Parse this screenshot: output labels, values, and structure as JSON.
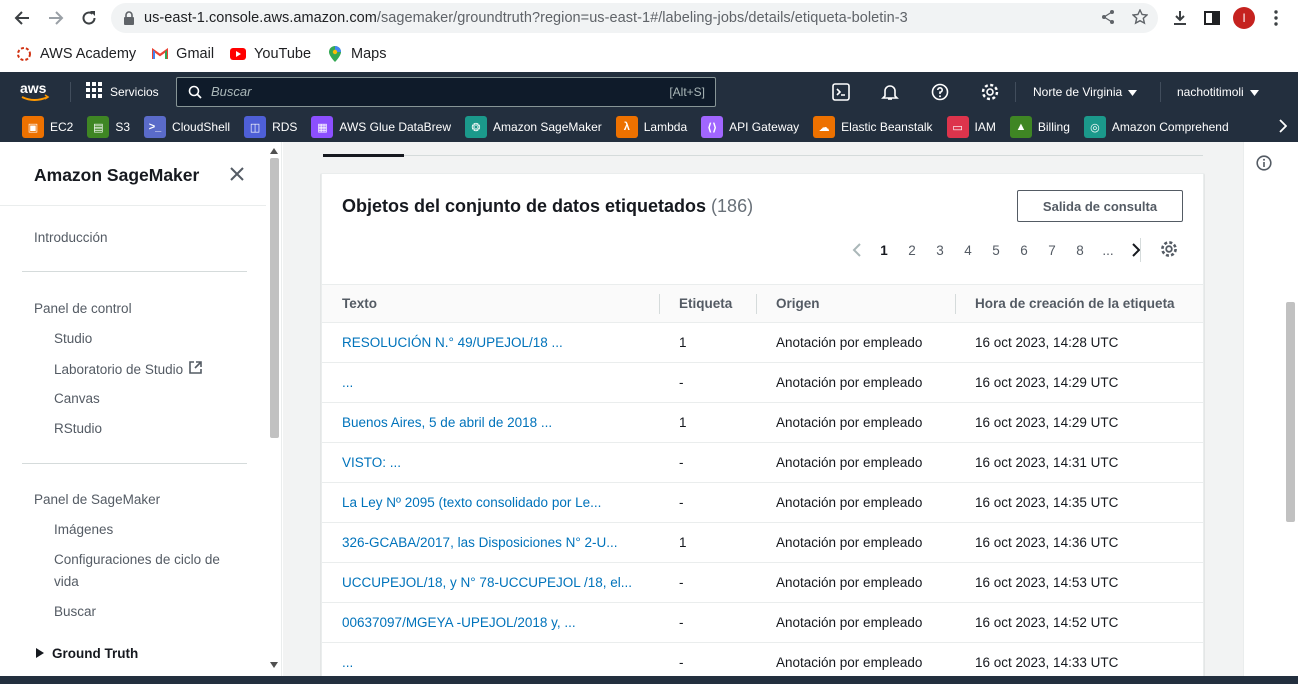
{
  "browser": {
    "url_host": "us-east-1.console.aws.amazon.com",
    "url_path": "/sagemaker/groundtruth?region=us-east-1#/labeling-jobs/details/etiqueta-boletin-3",
    "profile_initial": "I"
  },
  "bookmarks": [
    {
      "label": "AWS Academy",
      "icon": "aws-academy-icon"
    },
    {
      "label": "Gmail",
      "icon": "gmail-icon"
    },
    {
      "label": "YouTube",
      "icon": "youtube-icon"
    },
    {
      "label": "Maps",
      "icon": "maps-icon"
    }
  ],
  "aws_header": {
    "logo": "aws",
    "services_label": "Servicios",
    "search_placeholder": "Buscar",
    "search_shortcut": "[Alt+S]",
    "region": "Norte de Virginia",
    "user": "nachotitimoli"
  },
  "favorites": [
    {
      "label": "EC2",
      "color": "#ed7100",
      "glyph": "▣"
    },
    {
      "label": "S3",
      "color": "#3f8624",
      "glyph": "▤"
    },
    {
      "label": "CloudShell",
      "color": "#5a6bc9",
      "glyph": ">_"
    },
    {
      "label": "RDS",
      "color": "#4e5fd6",
      "glyph": "◫"
    },
    {
      "label": "AWS Glue DataBrew",
      "color": "#8c4fff",
      "glyph": "▦"
    },
    {
      "label": "Amazon SageMaker",
      "color": "#1b998b",
      "glyph": "❂"
    },
    {
      "label": "Lambda",
      "color": "#ed7100",
      "glyph": "λ"
    },
    {
      "label": "API Gateway",
      "color": "#a166ff",
      "glyph": "⟨⟩"
    },
    {
      "label": "Elastic Beanstalk",
      "color": "#ed7100",
      "glyph": "☁"
    },
    {
      "label": "IAM",
      "color": "#dd344c",
      "glyph": "▭"
    },
    {
      "label": "Billing",
      "color": "#3f8624",
      "glyph": "▲"
    },
    {
      "label": "Amazon Comprehend",
      "color": "#1b998b",
      "glyph": "◎"
    }
  ],
  "sidebar": {
    "title": "Amazon SageMaker",
    "intro": "Introducción",
    "section1": "Panel de control",
    "items1": [
      "Studio",
      "Laboratorio de Studio",
      "Canvas",
      "RStudio"
    ],
    "section2": "Panel de SageMaker",
    "items2": [
      "Imágenes",
      "Configuraciones de ciclo de",
      "vida",
      "Buscar"
    ],
    "ground_truth": "Ground Truth"
  },
  "panel": {
    "title": "Objetos del conjunto de datos etiquetados",
    "count": "(186)",
    "query_button": "Salida de consulta",
    "pages": [
      "1",
      "2",
      "3",
      "4",
      "5",
      "6",
      "7",
      "8",
      "..."
    ],
    "active_page": "1"
  },
  "table": {
    "headers": [
      "Texto",
      "Etiqueta",
      "Origen",
      "Hora de creación de la etiqueta"
    ],
    "rows": [
      {
        "text": "RESOLUCIÓN N.° 49/UPEJOL/18 ...",
        "label": "1",
        "origin": "Anotación por empleado",
        "time": "16 oct 2023, 14:28 UTC"
      },
      {
        "text": "...",
        "label": "-",
        "origin": "Anotación por empleado",
        "time": "16 oct 2023, 14:29 UTC"
      },
      {
        "text": "Buenos Aires, 5 de abril de 2018 ...",
        "label": "1",
        "origin": "Anotación por empleado",
        "time": "16 oct 2023, 14:29 UTC"
      },
      {
        "text": "VISTO: ...",
        "label": "-",
        "origin": "Anotación por empleado",
        "time": "16 oct 2023, 14:31 UTC"
      },
      {
        "text": "La Ley Nº 2095 (texto consolidado por Le...",
        "label": "-",
        "origin": "Anotación por empleado",
        "time": "16 oct 2023, 14:35 UTC"
      },
      {
        "text": "326-GCABA/2017, las Disposiciones N° 2-U...",
        "label": "1",
        "origin": "Anotación por empleado",
        "time": "16 oct 2023, 14:36 UTC"
      },
      {
        "text": "UCCUPEJOL/18, y N° 78-UCCUPEJOL /18, el...",
        "label": "-",
        "origin": "Anotación por empleado",
        "time": "16 oct 2023, 14:53 UTC"
      },
      {
        "text": "00637097/MGEYA -UPEJOL/2018 y, ...",
        "label": "-",
        "origin": "Anotación por empleado",
        "time": "16 oct 2023, 14:52 UTC"
      },
      {
        "text": "...",
        "label": "-",
        "origin": "Anotación por empleado",
        "time": "16 oct 2023, 14:33 UTC"
      }
    ]
  }
}
